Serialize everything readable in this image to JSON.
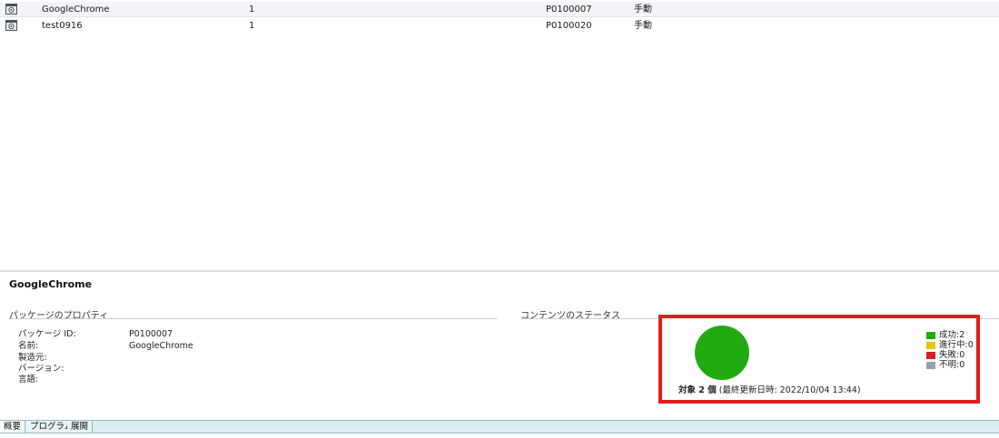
{
  "packages": [
    {
      "name": "GoogleChrome",
      "version": "1",
      "package_id": "P0100007",
      "mode": "手動"
    },
    {
      "name": "test0916",
      "version": "1",
      "package_id": "P0100020",
      "mode": "手動"
    }
  ],
  "detail": {
    "title": "GoogleChrome",
    "properties_header": "パッケージのプロパティ",
    "properties": [
      {
        "label": "パッケージ ID:",
        "value": "P0100007"
      },
      {
        "label": "名前:",
        "value": "GoogleChrome"
      },
      {
        "label": "製造元:",
        "value": ""
      },
      {
        "label": "バージョン:",
        "value": ""
      },
      {
        "label": "言語:",
        "value": ""
      }
    ],
    "status_header": "コンテンツのステータス"
  },
  "status": {
    "summary_bold": "対象 2 個",
    "summary_rest": " (最終更新日時: 2022/10/04 13:44)",
    "legend": [
      {
        "label": "成功:2",
        "color": "#22aa11",
        "count": 2
      },
      {
        "label": "進行中:0",
        "color": "#e8c40a",
        "count": 0
      },
      {
        "label": "失敗:0",
        "color": "#d42020",
        "count": 0
      },
      {
        "label": "不明:0",
        "color": "#9aa0a8",
        "count": 0
      }
    ]
  },
  "tabs": [
    "概要",
    "プログラム",
    "展開"
  ],
  "colors": {
    "highlight": "#e41b1b",
    "tabbar": "#daeef0"
  }
}
